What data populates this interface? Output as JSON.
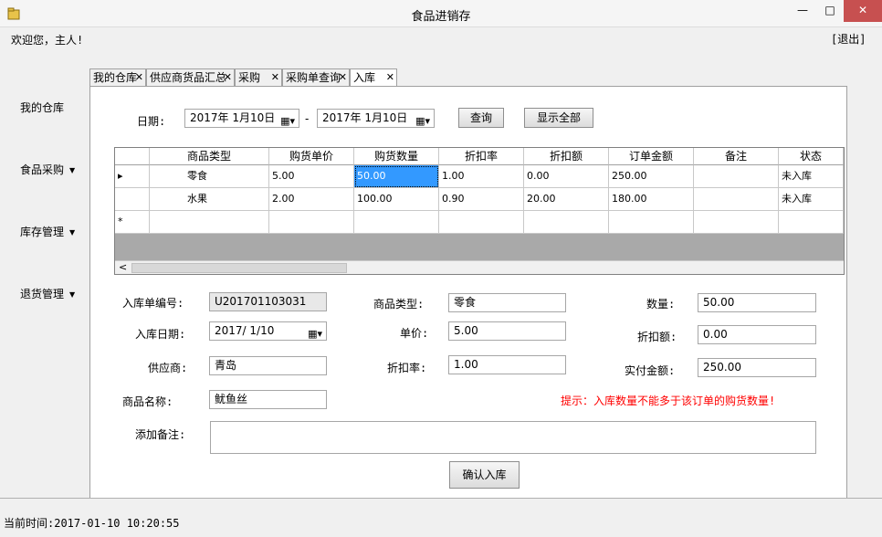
{
  "window": {
    "title": "食品进销存",
    "min_glyph": "—",
    "max_glyph": "□",
    "close_glyph": "✕"
  },
  "header": {
    "welcome": "欢迎您，主人!",
    "logout": "[退出]"
  },
  "nav": [
    {
      "label": "我的仓库",
      "has_caret": false
    },
    {
      "label": "食品采购",
      "has_caret": true
    },
    {
      "label": "库存管理",
      "has_caret": true
    },
    {
      "label": "退货管理",
      "has_caret": true
    }
  ],
  "tabs": [
    "我的仓库",
    "供应商货品汇总",
    "采购",
    "采购单查询",
    "入库"
  ],
  "query": {
    "date_label": "日期:",
    "date_from": "2017年  1月10日",
    "date_to": "2017年  1月10日",
    "separator": "-",
    "query_button": "查询",
    "show_all_button": "显示全部"
  },
  "grid": {
    "columns": [
      "商品类型",
      "购货单价",
      "购货数量",
      "折扣率",
      "折扣额",
      "订单金额",
      "备注",
      "状态"
    ],
    "rows": [
      [
        "零食",
        "5.00",
        "50.00",
        "1.00",
        "0.00",
        "250.00",
        "",
        "未入库"
      ],
      [
        "水果",
        "2.00",
        "100.00",
        "0.90",
        "20.00",
        "180.00",
        "",
        "未入库"
      ]
    ],
    "current_row_marker": "▸",
    "new_row_marker": "*",
    "scroll_left_glyph": "<"
  },
  "form": {
    "order_no_label": "入库单编号:",
    "order_no": "U201701103031",
    "date_label": "入库日期:",
    "date": "2017/ 1/10",
    "supplier_label": "供应商:",
    "supplier": "青岛",
    "product_name_label": "商品名称:",
    "product_name": "鱿鱼丝",
    "remark_label": "添加备注:",
    "remark": "",
    "category_label": "商品类型:",
    "category": "零食",
    "unit_price_label": "单价:",
    "unit_price": "5.00",
    "discount_rate_label": "折扣率:",
    "discount_rate": "1.00",
    "quantity_label": "数量:",
    "quantity": "50.00",
    "discount_amount_label": "折扣额:",
    "discount_amount": "0.00",
    "paid_amount_label": "实付金额:",
    "paid_amount": "250.00",
    "hint": "提示：入库数量不能多于该订单的购货数量!",
    "confirm_button": "确认入库"
  },
  "status": {
    "current_time": "当前时间:2017-01-10 10:20:55"
  }
}
